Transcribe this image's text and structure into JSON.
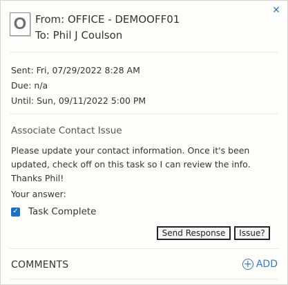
{
  "header": {
    "avatar_letter": "O",
    "from": "From: OFFICE - DEMOOFF01",
    "to": "To: Phil J Coulson",
    "close_icon": "close-icon"
  },
  "dates": {
    "sent": "Sent: Fri, 07/29/2022 8:28 AM",
    "due": "Due: n/a",
    "until": "Until: Sun, 09/11/2022 5:00 PM"
  },
  "task": {
    "title": "Associate Contact Issue",
    "description": "Please update your contact information. Once it's been updated, check off on this task so I can review the info. Thanks Phil!",
    "answer_label": "Your answer:",
    "complete_label": "Task Complete",
    "complete_checked": true
  },
  "actions": {
    "send_response": "Send Response",
    "issue": "Issue?"
  },
  "comments": {
    "title": "COMMENTS",
    "add_label": "ADD"
  },
  "colors": {
    "accent": "#2e7bbd",
    "checkbox": "#1a6fc9",
    "panel_bg": "#fffefb"
  }
}
